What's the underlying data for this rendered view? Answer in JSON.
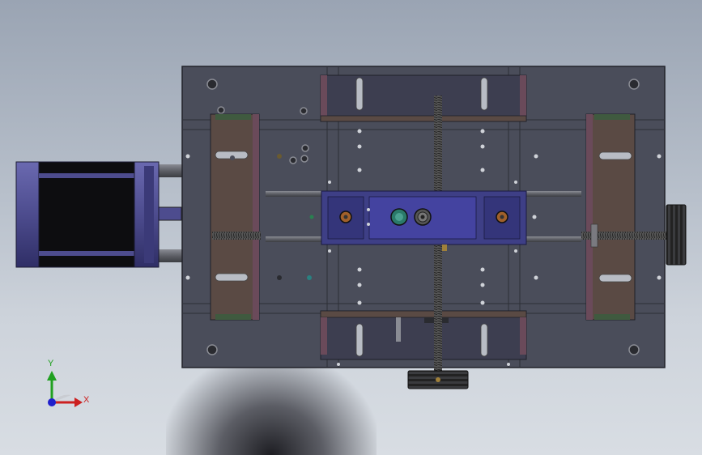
{
  "viewport": {
    "background_top": "#9aa4b3",
    "background_bottom": "#d8dde3"
  },
  "model": {
    "plate_color": "#4a4d5a",
    "plate_edge": "#22232a",
    "bracket_color": "#5a4a44",
    "motor_color": "#4d4c8e",
    "carriage_color": "#3e3f86",
    "screw_color": "#6a6a6a",
    "pulley_color": "#3a3b3e"
  },
  "triad": {
    "x_label": "X",
    "y_label": "Y",
    "x_color": "#cc2020",
    "y_color": "#20a020",
    "z_color": "#2020cc"
  }
}
